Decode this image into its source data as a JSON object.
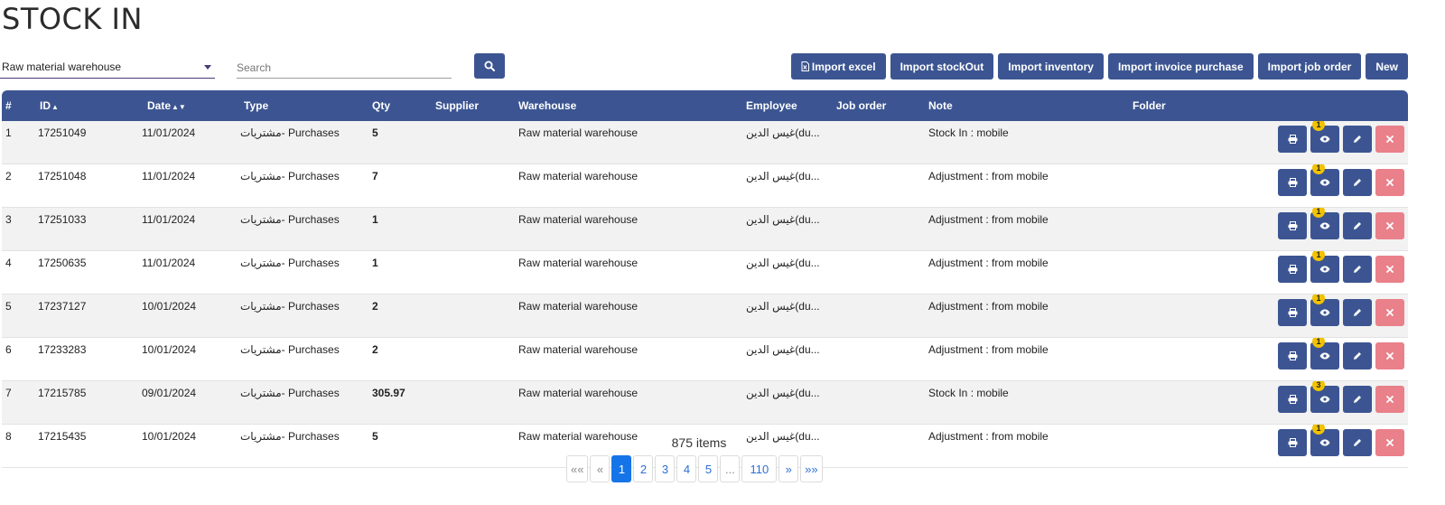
{
  "page": {
    "title": "STOCK IN"
  },
  "filters": {
    "warehouse": "Raw material warehouse",
    "search_placeholder": "Search"
  },
  "toolbar": {
    "import_excel": "Import excel",
    "import_stockout": "Import stockOut",
    "import_inventory": "Import inventory",
    "import_invoice_purchase": "Import invoice purchase",
    "import_job_order": "Import job order",
    "new": "New"
  },
  "table": {
    "headers": {
      "index": "#",
      "id": "ID",
      "date": "Date",
      "type": "Type",
      "qty": "Qty",
      "supplier": "Supplier",
      "warehouse": "Warehouse",
      "employee": "Employee",
      "job_order": "Job order",
      "note": "Note",
      "folder": "Folder"
    },
    "rows": [
      {
        "n": "1",
        "id": "17251049",
        "date": "11/01/2024",
        "type": "مشتريات- Purchases",
        "qty": "5",
        "supplier": "",
        "warehouse": "Raw material warehouse",
        "employee": "غيس الدين(du...",
        "job_order": "",
        "note": "Stock In : mobile",
        "folder": "",
        "badge": "1"
      },
      {
        "n": "2",
        "id": "17251048",
        "date": "11/01/2024",
        "type": "مشتريات- Purchases",
        "qty": "7",
        "supplier": "",
        "warehouse": "Raw material warehouse",
        "employee": "غيس الدين(du...",
        "job_order": "",
        "note": "Adjustment : from mobile",
        "folder": "",
        "badge": "1"
      },
      {
        "n": "3",
        "id": "17251033",
        "date": "11/01/2024",
        "type": "مشتريات- Purchases",
        "qty": "1",
        "supplier": "",
        "warehouse": "Raw material warehouse",
        "employee": "غيس الدين(du...",
        "job_order": "",
        "note": "Adjustment : from mobile",
        "folder": "",
        "badge": "1"
      },
      {
        "n": "4",
        "id": "17250635",
        "date": "11/01/2024",
        "type": "مشتريات- Purchases",
        "qty": "1",
        "supplier": "",
        "warehouse": "Raw material warehouse",
        "employee": "غيس الدين(du...",
        "job_order": "",
        "note": "Adjustment : from mobile",
        "folder": "",
        "badge": "1"
      },
      {
        "n": "5",
        "id": "17237127",
        "date": "10/01/2024",
        "type": "مشتريات- Purchases",
        "qty": "2",
        "supplier": "",
        "warehouse": "Raw material warehouse",
        "employee": "غيس الدين(du...",
        "job_order": "",
        "note": "Adjustment : from mobile",
        "folder": "",
        "badge": "1"
      },
      {
        "n": "6",
        "id": "17233283",
        "date": "10/01/2024",
        "type": "مشتريات- Purchases",
        "qty": "2",
        "supplier": "",
        "warehouse": "Raw material warehouse",
        "employee": "غيس الدين(du...",
        "job_order": "",
        "note": "Adjustment : from mobile",
        "folder": "",
        "badge": "1"
      },
      {
        "n": "7",
        "id": "17215785",
        "date": "09/01/2024",
        "type": "مشتريات- Purchases",
        "qty": "305.97",
        "supplier": "",
        "warehouse": "Raw material warehouse",
        "employee": "غيس الدين(du...",
        "job_order": "",
        "note": "Stock In : mobile",
        "folder": "",
        "badge": "3"
      },
      {
        "n": "8",
        "id": "17215435",
        "date": "10/01/2024",
        "type": "مشتريات- Purchases",
        "qty": "5",
        "supplier": "",
        "warehouse": "Raw material warehouse",
        "employee": "غيس الدين(du...",
        "job_order": "",
        "note": "Adjustment : from mobile",
        "folder": "",
        "badge": "1"
      }
    ]
  },
  "pagination": {
    "items_count": "875 items",
    "first": "««",
    "prev": "«",
    "pages": [
      "1",
      "2",
      "3",
      "4",
      "5",
      "...",
      "110"
    ],
    "next": "»",
    "last": "»»",
    "current": "1"
  },
  "icons": {
    "search": "search-icon",
    "file": "file-excel-icon",
    "print": "print-icon",
    "view": "eye-icon",
    "edit": "pencil-icon",
    "delete": "close-icon",
    "sort_asc": "sort-up-icon",
    "sort_both": "sort-icon"
  },
  "colors": {
    "primary": "#3c5592",
    "danger": "#e9808a",
    "badge": "#f2c200",
    "page_active": "#1575e8",
    "row_alt": "#f2f2f2"
  }
}
